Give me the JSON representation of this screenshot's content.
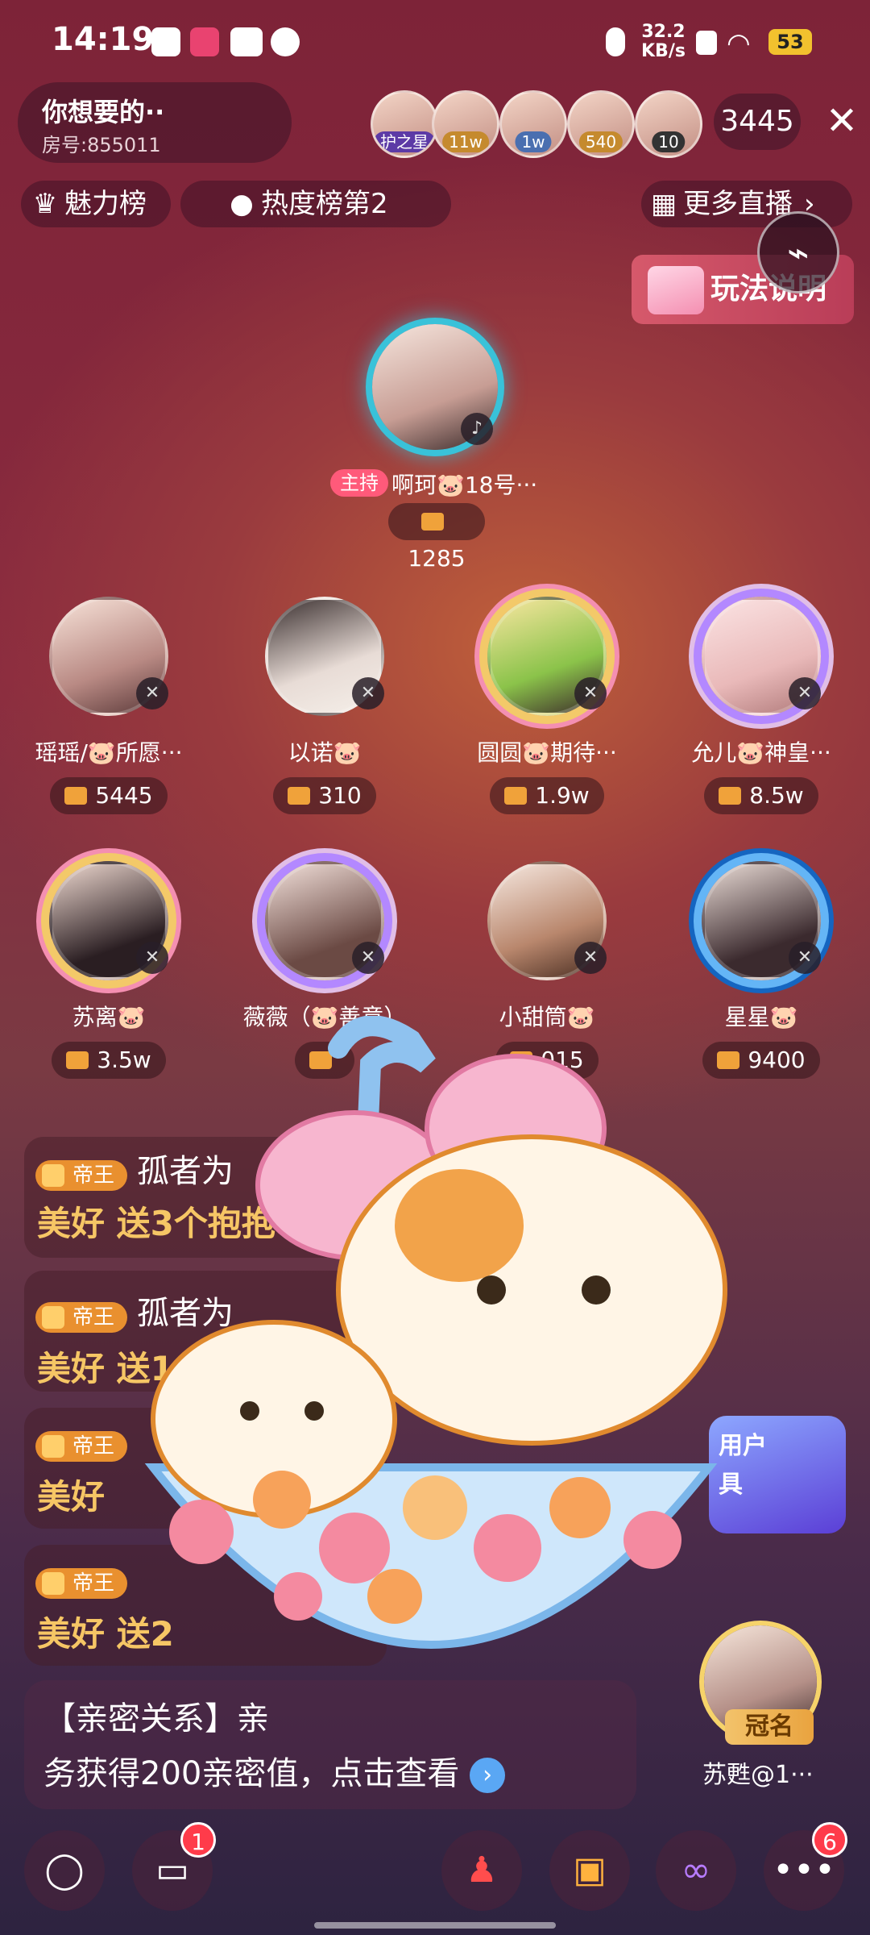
{
  "status": {
    "time": "14:19",
    "net_speed_value": "32.2",
    "net_speed_unit": "KB/s",
    "battery": "53"
  },
  "room": {
    "title": "你想要的··",
    "room_id": "房号:855011",
    "online_count": "3445"
  },
  "viewers": [
    {
      "badge": "护之星",
      "color": "#5c3aa6"
    },
    {
      "badge": "11w",
      "color": "#c58a2e"
    },
    {
      "badge": "1w",
      "color": "#4a6fb0"
    },
    {
      "badge": "540",
      "color": "#c58a2e"
    },
    {
      "badge": "10",
      "color": "#333333"
    }
  ],
  "ranking": {
    "charm": "魅力榜",
    "heat": "热度榜第2",
    "more_live": "更多直播"
  },
  "rules_button": "玩法说明",
  "host": {
    "tag": "主持",
    "name": "啊珂🐷18号···",
    "score": "1285"
  },
  "seats": [
    {
      "name": "瑶瑶/🐷所愿···",
      "score": "5445"
    },
    {
      "name": "以诺🐷",
      "score": "310"
    },
    {
      "name": "圆圆🐷期待···",
      "score": "1.9w"
    },
    {
      "name": "允儿🐷神皇···",
      "score": "8.5w"
    },
    {
      "name": "苏离🐷",
      "score": "3.5w"
    },
    {
      "name": "薇薇（🐷善意）",
      "score": ""
    },
    {
      "name": "小甜筒🐷",
      "score": "015"
    },
    {
      "name": "星星🐷",
      "score": "9400"
    }
  ],
  "chat": [
    {
      "level": "帝王",
      "user": "孤者为",
      "text": "美好 送3个抱抱"
    },
    {
      "level": "帝王",
      "user": "孤者为",
      "text": "美好 送1"
    },
    {
      "level": "帝王",
      "user": "",
      "text": "美好"
    },
    {
      "level": "帝王",
      "user": "",
      "text": "美好 送2"
    }
  ],
  "intimacy": {
    "line1": "【亲密关系】亲",
    "line2": "务获得200亲密值，点击查看"
  },
  "promo": {
    "line1": "用户",
    "line2": "具"
  },
  "crown": {
    "tag": "冠名",
    "name": "苏甦@1···"
  },
  "bottom": {
    "messages_badge": "1",
    "more_badge": "6"
  }
}
